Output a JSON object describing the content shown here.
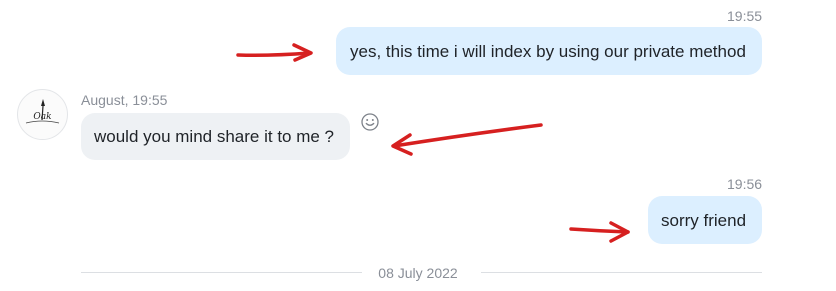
{
  "messages": [
    {
      "direction": "outgoing",
      "timestamp": "19:55",
      "text": "yes, this time i will index by using our private method"
    },
    {
      "direction": "incoming",
      "sender": "August",
      "timestamp": "19:55",
      "sender_line": "August, 19:55",
      "text": "would you mind share it to me ?",
      "avatar_text": "Oak"
    },
    {
      "direction": "outgoing",
      "timestamp": "19:56",
      "text": "sorry friend"
    }
  ],
  "date_divider": "08 July 2022",
  "icons": {
    "reaction": "smiley-face-icon",
    "annotation": "red-arrow-icon"
  },
  "colors": {
    "outgoing_bubble": "#dcefff",
    "incoming_bubble": "#eef1f4",
    "timestamp": "#8a8f98",
    "annotation_red": "#d62020"
  }
}
